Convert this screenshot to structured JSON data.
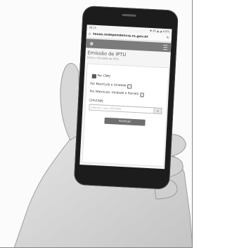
{
  "status_bar": {
    "time": "09:15",
    "indicators": "✱ 4G ▲ ◢ 100%"
  },
  "browser": {
    "home_icon": "home-icon",
    "url": "taxas.independencia.rs.gov.br",
    "refresh_icon": "refresh-icon"
  },
  "site_header": {
    "home_icon": "home-icon",
    "menu_icon": "menu-icon"
  },
  "page": {
    "title": "Emissão de IPTU",
    "breadcrumb": "Início > Emissão de IPTU",
    "search_options": [
      {
        "label": "Por CNPJ",
        "checked": true
      },
      {
        "label": "Por Matrícula e Unidade",
        "checked": false
      },
      {
        "label": "Por Matrícula, Unidade e Parcela",
        "checked": false
      }
    ],
    "field_label": "CPF/CNPJ",
    "field_placeholder": "Informe o seu CPF/CNPJ",
    "clear_glyph": "×",
    "submit_label": "Avançar"
  },
  "colors": {
    "device": "#1c1c1c",
    "site_header": "#7b7b7b",
    "button": "#6f6f6f",
    "skin": "#d9d9d9"
  }
}
